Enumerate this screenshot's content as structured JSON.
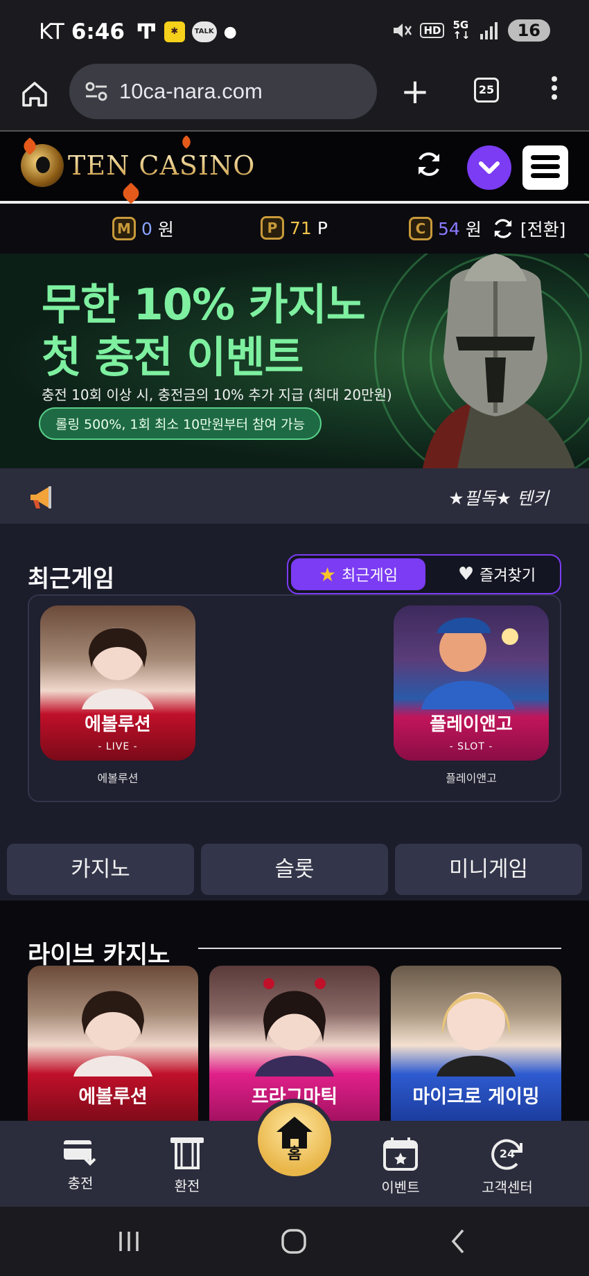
{
  "statusbar": {
    "carrier": "KT",
    "time": "6:46",
    "kakao": "카카오",
    "talk": "TALK",
    "battery": "16"
  },
  "browser": {
    "url": "10ca-nara.com",
    "tab_count": "25"
  },
  "site": {
    "logo_text": "TEN CASINO"
  },
  "balance": {
    "m": {
      "icon": "M",
      "value": "0",
      "unit": "원"
    },
    "p": {
      "icon": "P",
      "value": "71",
      "unit": "P"
    },
    "c": {
      "icon": "C",
      "value": "54",
      "unit": "원"
    },
    "switch_label": "[전환]"
  },
  "banner": {
    "line1": "무한 10% 카지노",
    "line2": "첫 충전 이벤트",
    "sub": "충전 10회 이상 시, 충전금의 10% 추가 지급 (최대 20만원)",
    "pill": "롤링 500%, 1회 최소 10만원부터 참여 가능"
  },
  "notice": {
    "text": "★필독★ 텐키"
  },
  "recent": {
    "title": "최근게임",
    "tab_active": "최근게임",
    "tab_inactive": "즐겨찾기",
    "games": [
      {
        "card_name": "에볼루션",
        "card_type": "- LIVE -",
        "caption": "에볼루션"
      },
      {
        "card_name": "플레이앤고",
        "card_type": "- SLOT -",
        "caption": "플레이앤고"
      }
    ]
  },
  "categories": [
    "카지노",
    "슬롯",
    "미니게임"
  ],
  "live": {
    "title": "라이브 카지노",
    "cards": [
      "에볼루션",
      "프라그마틱",
      "마이크로 게이밍"
    ]
  },
  "bottom_nav": {
    "charge": "충전",
    "exchange": "환전",
    "home": "홈",
    "event": "이벤트",
    "support": "고객센터",
    "support_badge": "24"
  },
  "colors": {
    "accent": "#7b3cf3",
    "gold": "#e9b64a",
    "bg": "#1c1d2b"
  }
}
